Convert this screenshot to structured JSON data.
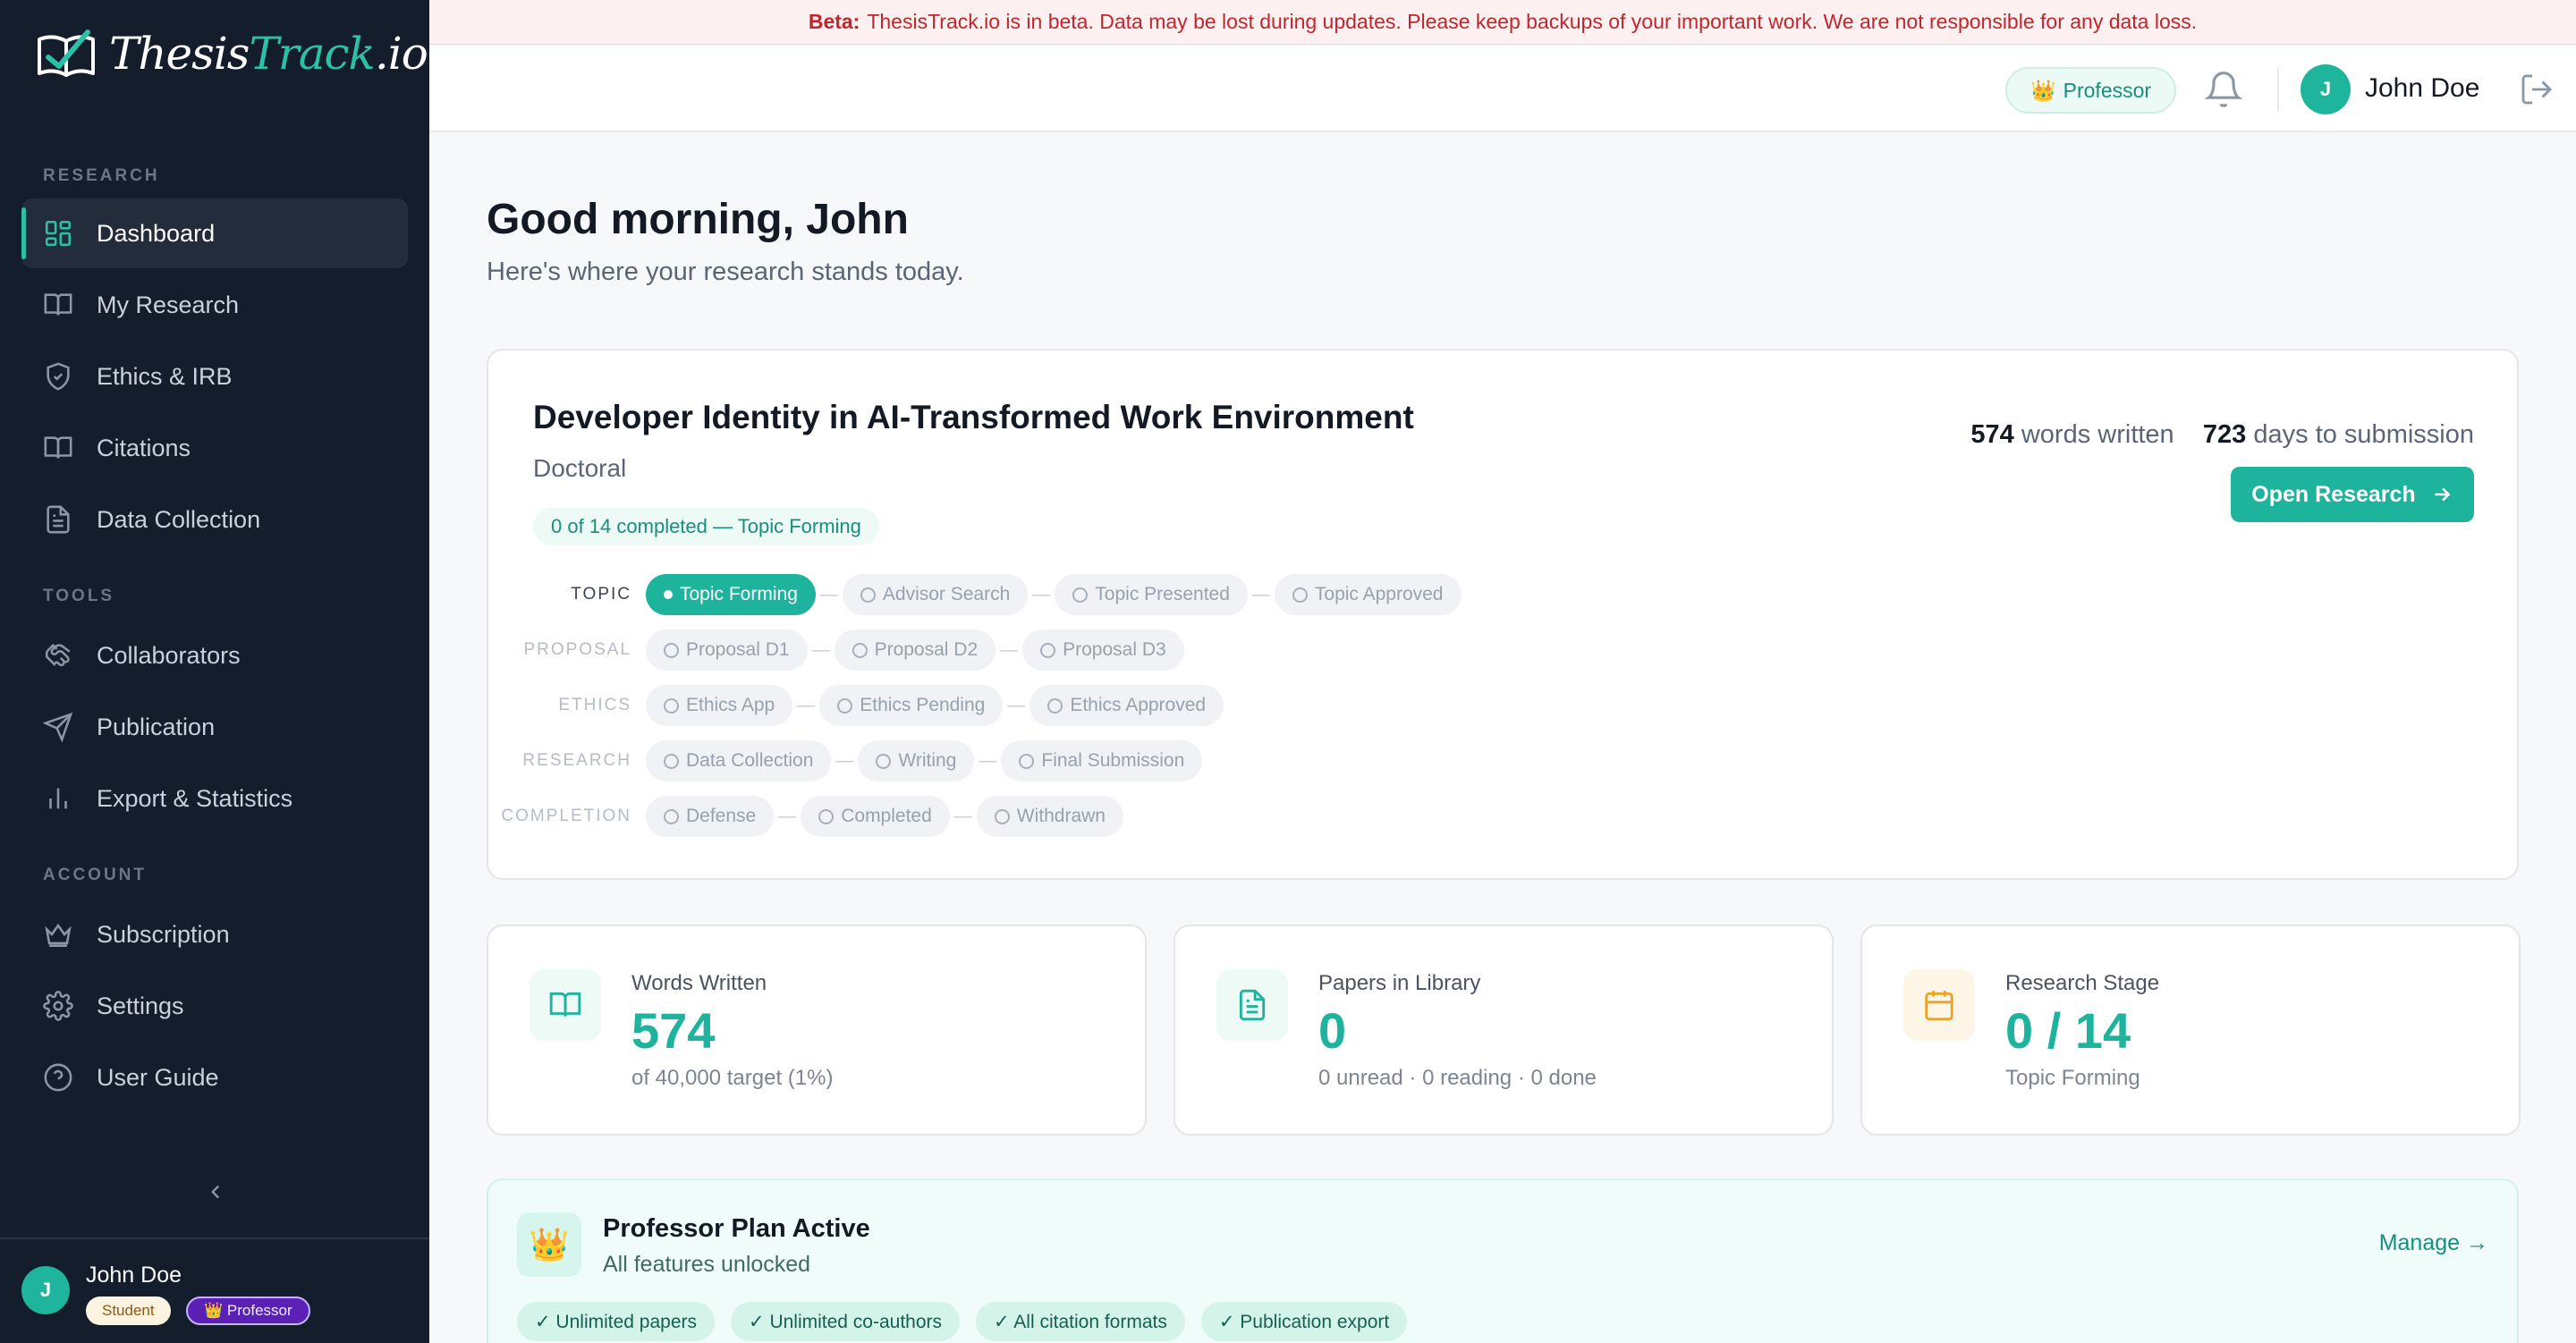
{
  "app": {
    "logo_prefix": "Thesis",
    "logo_track": "Track",
    "logo_suffix": ".io"
  },
  "beta": {
    "label": "Beta:",
    "message": "ThesisTrack.io is in beta. Data may be lost during updates. Please keep backups of your important work. We are not responsible for any data loss."
  },
  "sidebar": {
    "sections": [
      "RESEARCH",
      "TOOLS",
      "ACCOUNT"
    ],
    "items": [
      {
        "label": "Dashboard",
        "icon": "dashboard-icon"
      },
      {
        "label": "My Research",
        "icon": "book-icon"
      },
      {
        "label": "Ethics & IRB",
        "icon": "shield-icon"
      },
      {
        "label": "Citations",
        "icon": "book-open-icon"
      },
      {
        "label": "Data Collection",
        "icon": "document-icon"
      },
      {
        "label": "Collaborators",
        "icon": "handshake-icon"
      },
      {
        "label": "Publication",
        "icon": "send-icon"
      },
      {
        "label": "Export & Statistics",
        "icon": "bar-chart-icon"
      },
      {
        "label": "Subscription",
        "icon": "crown-icon"
      },
      {
        "label": "Settings",
        "icon": "gear-icon"
      },
      {
        "label": "User Guide",
        "icon": "help-circle-icon"
      }
    ],
    "user": {
      "initial": "J",
      "name": "John Doe",
      "badge_student": "Student",
      "badge_professor": "👑 Professor"
    }
  },
  "header": {
    "role": "Professor",
    "role_icon": "👑",
    "user_initial": "J",
    "user_name": "John Doe"
  },
  "main": {
    "greeting": "Good morning, John",
    "subtitle": "Here's where your research stands today."
  },
  "research": {
    "title": "Developer Identity in AI-Transformed Work Environment",
    "level": "Doctoral",
    "progress": "0 of 14 completed — Topic Forming",
    "words_value": "574",
    "words_label": "words written",
    "days_value": "723",
    "days_label": "days to submission",
    "open_button": "Open Research",
    "stages": [
      {
        "label": "TOPIC",
        "steps": [
          "Topic Forming",
          "Advisor Search",
          "Topic Presented",
          "Topic Approved"
        ]
      },
      {
        "label": "PROPOSAL",
        "steps": [
          "Proposal D1",
          "Proposal D2",
          "Proposal D3"
        ]
      },
      {
        "label": "ETHICS",
        "steps": [
          "Ethics App",
          "Ethics Pending",
          "Ethics Approved"
        ]
      },
      {
        "label": "RESEARCH",
        "steps": [
          "Data Collection",
          "Writing",
          "Final Submission"
        ]
      },
      {
        "label": "COMPLETION",
        "steps": [
          "Defense",
          "Completed",
          "Withdrawn"
        ]
      }
    ]
  },
  "stats": [
    {
      "label": "Words Written",
      "value": "574",
      "sub": "of 40,000 target (1%)",
      "icon": "book-open-icon"
    },
    {
      "label": "Papers in Library",
      "value": "0",
      "sub": "0 unread · 0 reading · 0 done",
      "icon": "document-icon"
    },
    {
      "label": "Research Stage",
      "value": "0 / 14",
      "sub": "Topic Forming",
      "icon": "calendar-icon"
    }
  ],
  "plan": {
    "icon": "👑",
    "title": "Professor Plan Active",
    "subtitle": "All features unlocked",
    "manage": "Manage →",
    "features": [
      "✓ Unlimited papers",
      "✓ Unlimited co-authors",
      "✓ All citation formats",
      "✓ Publication export"
    ]
  },
  "colors": {
    "accent": "#1eb39c",
    "sidebar_bg": "#141d2b",
    "beta_text": "#c0262d"
  }
}
